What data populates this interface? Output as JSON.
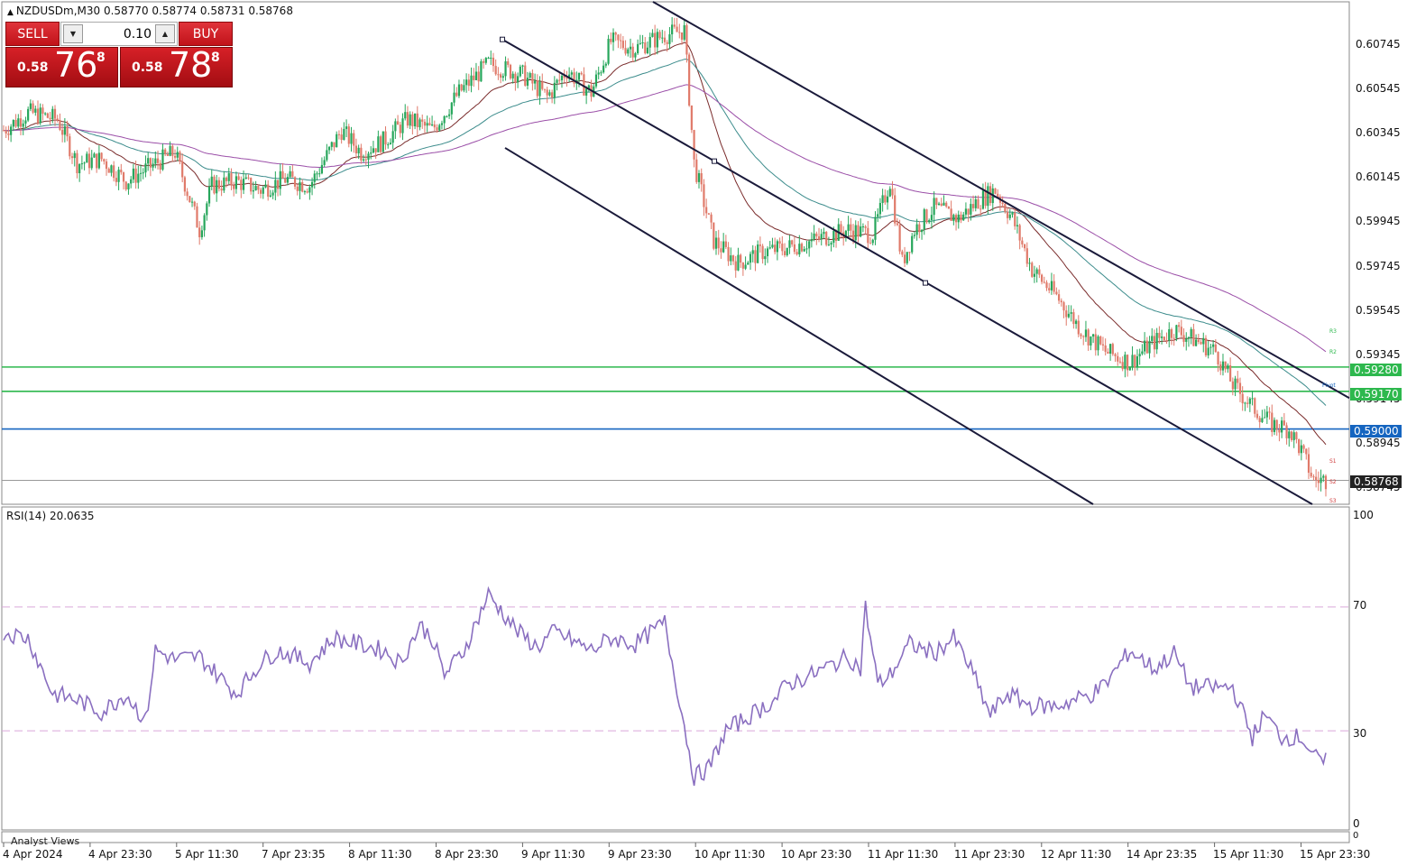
{
  "header": {
    "symbol": "NZDUSDm,M30",
    "open": "0.58770",
    "high": "0.58774",
    "low": "0.58731",
    "close": "0.58768"
  },
  "trade_panel": {
    "sell_label": "SELL",
    "buy_label": "BUY",
    "lot_value": "0.10",
    "sell_big": "0.58",
    "sell_mid": "76",
    "sell_sup": "8",
    "buy_big": "0.58",
    "buy_mid": "78",
    "buy_sup": "8"
  },
  "price_axis": {
    "labels": [
      "0.60745",
      "0.60545",
      "0.60345",
      "0.60145",
      "0.59945",
      "0.59745",
      "0.59545",
      "0.59345",
      "0.59145",
      "0.58945",
      "0.58745"
    ],
    "tags": [
      {
        "value": "0.59280",
        "color": "#2db84d"
      },
      {
        "value": "0.59170",
        "color": "#2db84d"
      },
      {
        "value": "0.59000",
        "color": "#1565c0"
      },
      {
        "value": "0.58768",
        "color": "#222222"
      }
    ]
  },
  "pivot_labels": [
    "R3",
    "R2",
    "Pivot",
    "S1",
    "S2",
    "S3"
  ],
  "time_axis": [
    "4 Apr 2024",
    "4 Apr 23:30",
    "5 Apr 11:30",
    "7 Apr 23:35",
    "8 Apr 11:30",
    "8 Apr 23:30",
    "9 Apr 11:30",
    "9 Apr 23:30",
    "10 Apr 11:30",
    "10 Apr 23:30",
    "11 Apr 11:30",
    "11 Apr 23:30",
    "12 Apr 11:30",
    "14 Apr 23:35",
    "15 Apr 11:30",
    "15 Apr 23:30"
  ],
  "rsi": {
    "label": "RSI(14) 20.0635",
    "levels": [
      "100",
      "70",
      "30",
      "0"
    ],
    "current": 20.0635
  },
  "bottom_panel": {
    "label": "Analyst Views",
    "value": "0"
  },
  "colors": {
    "bull": "#26a65b",
    "bear": "#e07a6a",
    "rsi": "#8a6fc0",
    "ma_fast": "#7a2b2b",
    "ma_mid": "#3c8c8c",
    "ma_slow": "#9b4fa8",
    "channel": "#1a1a3a"
  },
  "chart_data": {
    "type": "candlestick",
    "symbol": "NZDUSDm",
    "timeframe": "M30",
    "y_range": [
      0.5866,
      0.6093
    ],
    "close_path": [
      [
        0,
        0.6035
      ],
      [
        10,
        0.6043
      ],
      [
        22,
        0.604
      ],
      [
        30,
        0.602
      ],
      [
        40,
        0.6022
      ],
      [
        50,
        0.6012
      ],
      [
        62,
        0.602
      ],
      [
        70,
        0.6025
      ],
      [
        80,
        0.599
      ],
      [
        85,
        0.601
      ],
      [
        95,
        0.6012
      ],
      [
        105,
        0.6008
      ],
      [
        115,
        0.6013
      ],
      [
        125,
        0.601
      ],
      [
        138,
        0.6035
      ],
      [
        146,
        0.6025
      ],
      [
        155,
        0.603
      ],
      [
        165,
        0.604
      ],
      [
        175,
        0.6035
      ],
      [
        186,
        0.6052
      ],
      [
        198,
        0.6065
      ],
      [
        212,
        0.606
      ],
      [
        222,
        0.605
      ],
      [
        230,
        0.6062
      ],
      [
        240,
        0.6052
      ],
      [
        248,
        0.6075
      ],
      [
        258,
        0.6072
      ],
      [
        270,
        0.6078
      ],
      [
        278,
        0.608
      ],
      [
        282,
        0.602
      ],
      [
        290,
        0.5985
      ],
      [
        300,
        0.5975
      ],
      [
        310,
        0.598
      ],
      [
        320,
        0.5982
      ],
      [
        330,
        0.5985
      ],
      [
        345,
        0.599
      ],
      [
        355,
        0.5988
      ],
      [
        362,
        0.6012
      ],
      [
        367,
        0.5975
      ],
      [
        372,
        0.599
      ],
      [
        380,
        0.6
      ],
      [
        390,
        0.5995
      ],
      [
        398,
        0.6003
      ],
      [
        405,
        0.6008
      ],
      [
        412,
        0.5995
      ],
      [
        420,
        0.5972
      ],
      [
        430,
        0.596
      ],
      [
        440,
        0.5945
      ],
      [
        450,
        0.5935
      ],
      [
        460,
        0.593
      ],
      [
        468,
        0.5938
      ],
      [
        478,
        0.5945
      ],
      [
        487,
        0.594
      ],
      [
        495,
        0.5935
      ],
      [
        502,
        0.592
      ],
      [
        510,
        0.591
      ],
      [
        518,
        0.5902
      ],
      [
        525,
        0.59
      ],
      [
        530,
        0.589
      ],
      [
        535,
        0.5877
      ]
    ],
    "horizontal_levels": [
      0.5928,
      0.5917,
      0.59,
      0.58768
    ],
    "rsi_series": [
      [
        0,
        62
      ],
      [
        10,
        60
      ],
      [
        20,
        42
      ],
      [
        30,
        40
      ],
      [
        40,
        36
      ],
      [
        50,
        42
      ],
      [
        58,
        33
      ],
      [
        62,
        56
      ],
      [
        70,
        53
      ],
      [
        80,
        54
      ],
      [
        95,
        42
      ],
      [
        105,
        52
      ],
      [
        112,
        56
      ],
      [
        125,
        52
      ],
      [
        135,
        60
      ],
      [
        145,
        58
      ],
      [
        155,
        56
      ],
      [
        162,
        52
      ],
      [
        170,
        64
      ],
      [
        175,
        60
      ],
      [
        180,
        48
      ],
      [
        188,
        56
      ],
      [
        198,
        74
      ],
      [
        210,
        62
      ],
      [
        218,
        57
      ],
      [
        225,
        62
      ],
      [
        230,
        60
      ],
      [
        240,
        56
      ],
      [
        248,
        60
      ],
      [
        258,
        58
      ],
      [
        265,
        62
      ],
      [
        270,
        65
      ],
      [
        282,
        15
      ],
      [
        288,
        18
      ],
      [
        295,
        30
      ],
      [
        305,
        35
      ],
      [
        315,
        40
      ],
      [
        320,
        45
      ],
      [
        330,
        48
      ],
      [
        345,
        54
      ],
      [
        350,
        50
      ],
      [
        352,
        70
      ],
      [
        357,
        45
      ],
      [
        362,
        48
      ],
      [
        370,
        58
      ],
      [
        380,
        55
      ],
      [
        388,
        60
      ],
      [
        395,
        50
      ],
      [
        403,
        35
      ],
      [
        410,
        42
      ],
      [
        420,
        38
      ],
      [
        430,
        38
      ],
      [
        445,
        42
      ],
      [
        450,
        45
      ],
      [
        460,
        56
      ],
      [
        470,
        50
      ],
      [
        478,
        55
      ],
      [
        485,
        44
      ],
      [
        492,
        44
      ],
      [
        502,
        44
      ],
      [
        510,
        28
      ],
      [
        515,
        35
      ],
      [
        522,
        28
      ],
      [
        530,
        28
      ],
      [
        537,
        20
      ]
    ]
  }
}
